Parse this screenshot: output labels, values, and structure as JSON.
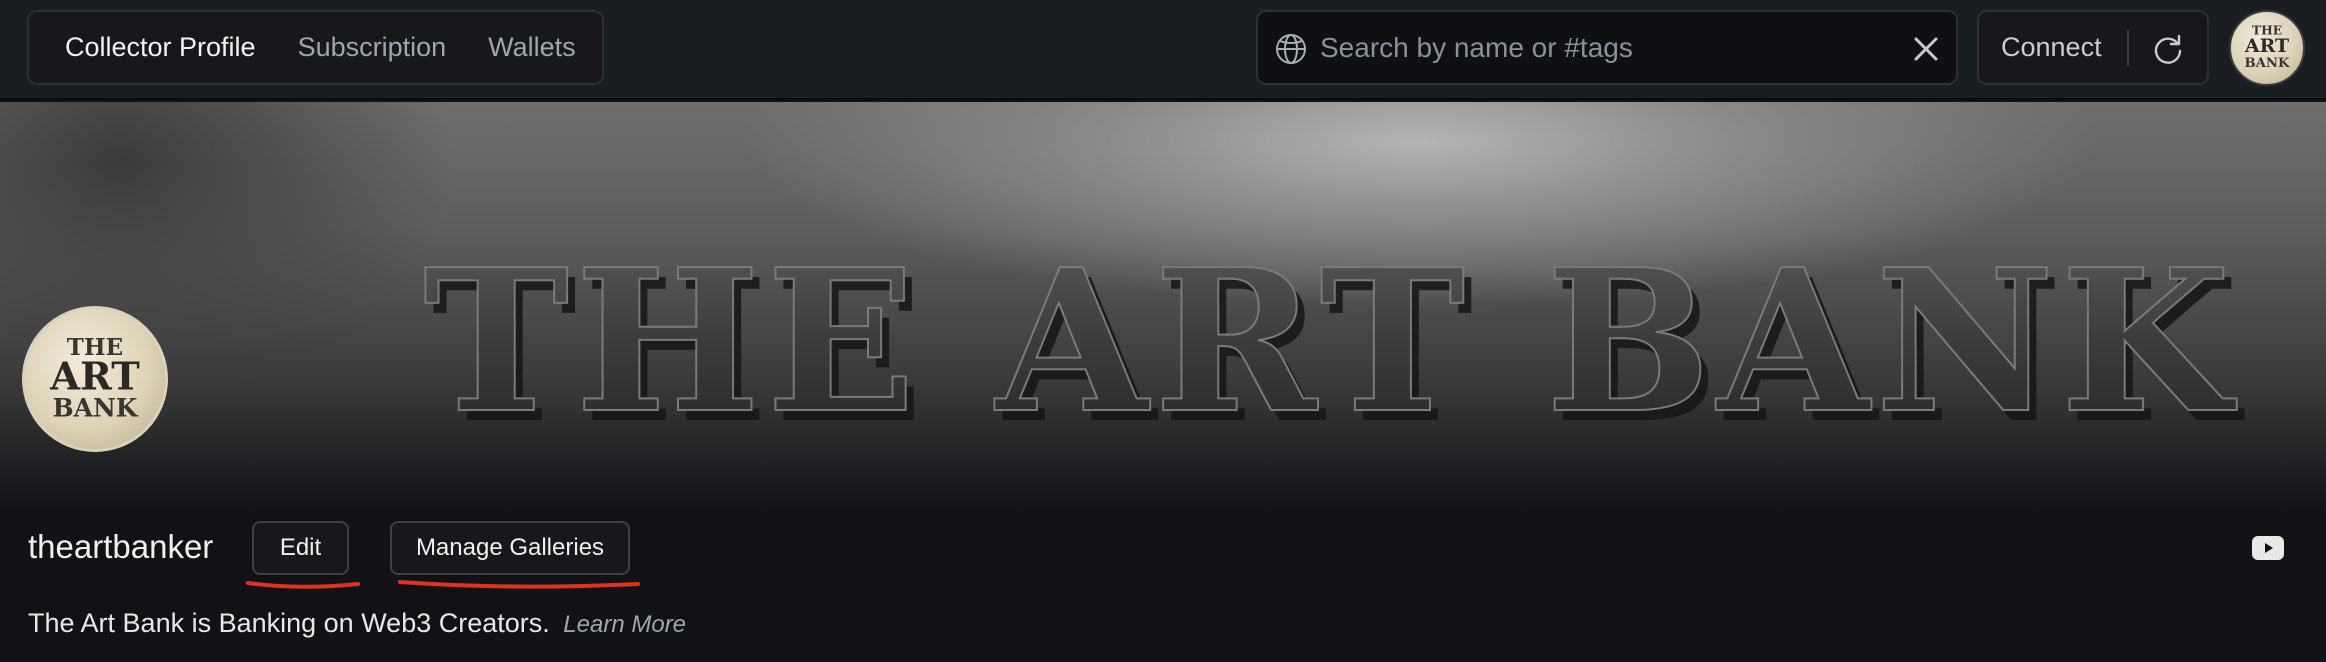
{
  "nav": {
    "tabs": [
      {
        "label": "Collector Profile",
        "active": true
      },
      {
        "label": "Subscription",
        "active": false
      },
      {
        "label": "Wallets",
        "active": false
      }
    ]
  },
  "search": {
    "placeholder": "Search by name or #tags",
    "value": "",
    "icon": "globe-icon",
    "clear_icon": "close-icon"
  },
  "account": {
    "connect_label": "Connect",
    "refresh_icon": "refresh-icon",
    "avatar_logo": "The Art Bank logo"
  },
  "banner": {
    "headline": "THE ART BANK"
  },
  "profile": {
    "avatar_text": [
      "THE",
      "ART",
      "BANK"
    ],
    "username": "theartbanker",
    "edit_label": "Edit",
    "manage_label": "Manage Galleries",
    "bio": "The Art Bank is Banking on Web3 Creators.",
    "learn_more": "Learn More",
    "social_icon": "youtube-icon"
  },
  "colors": {
    "background": "#101215",
    "topbar": "#1a1d22",
    "annotation_underline": "#e0321e"
  }
}
